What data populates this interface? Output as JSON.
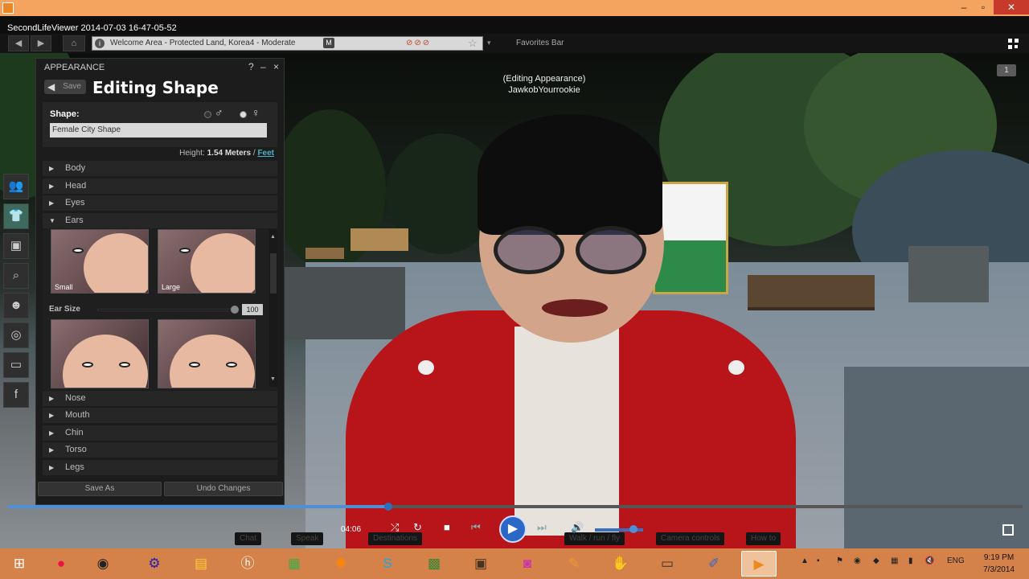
{
  "window": {
    "controls": {
      "minimize": "–",
      "maximize": "▫",
      "close": "✕"
    }
  },
  "viewer": {
    "title": "SecondLifeViewer 2014-07-03 16-47-05-52",
    "nav": {
      "back": "◀",
      "forward": "▶",
      "home": "⌂"
    },
    "location": {
      "info": "i",
      "text": "Welcome Area - Protected Land, Korea4 - Moderate",
      "rating_badge": "M",
      "status_icons": "⊘⊘⊘",
      "star": "☆"
    },
    "favorites_dropdown": "▾",
    "favorites_bar": "Favorites Bar"
  },
  "scene": {
    "avatar_status": "(Editing Appearance)",
    "avatar_name": "JawkobYourrookie",
    "corner_badge": "1"
  },
  "appearance_panel": {
    "header": "APPEARANCE",
    "help": "?",
    "minimize": "–",
    "close": "×",
    "back_label": "Save",
    "title": "Editing Shape",
    "shape_label": "Shape:",
    "male_symbol": "♂",
    "female_symbol": "♀",
    "shape_name": "Female City Shape",
    "height_label": "Height:",
    "height_value": "1.54 Meters",
    "height_sep": "/",
    "height_unit_link": "Feet",
    "sections_top": [
      "Body",
      "Head",
      "Eyes",
      "Ears"
    ],
    "sections_bottom": [
      "Nose",
      "Mouth",
      "Chin",
      "Torso",
      "Legs"
    ],
    "ear_thumbs": [
      "Small",
      "Large"
    ],
    "slider_label": "Ear Size",
    "slider_value": "100",
    "slider_fraction": 1.0,
    "save_as": "Save As",
    "undo": "Undo Changes"
  },
  "left_toolbar": [
    "people-icon",
    "clothing-icon",
    "inventory-icon",
    "search-icon",
    "avatar-icon",
    "radar-icon",
    "snapshot-icon",
    "facebook-icon"
  ],
  "player": {
    "time": "04:06",
    "progress_fraction": 0.375,
    "volume_fraction": 0.8,
    "ghost_buttons": [
      "Chat",
      "Speak",
      "Destinations",
      "Walk / run / fly",
      "Camera controls",
      "How to"
    ]
  },
  "taskbar": {
    "apps": [
      "Windows",
      "Firefox",
      "Steam",
      "Settings",
      "File Explorer",
      "HP",
      "Game",
      "Avast",
      "Skype",
      "Minecraft",
      "Minecraft Server",
      "Photo",
      "Tools",
      "Second Life",
      "Computer",
      "Paint",
      "Media Player"
    ],
    "language": "ENG",
    "time": "9:19 PM",
    "date": "7/3/2014"
  },
  "colors": {
    "taskbar": "#d4824a",
    "accent": "#4f8fd6",
    "titlebar": "#f4a45f"
  }
}
